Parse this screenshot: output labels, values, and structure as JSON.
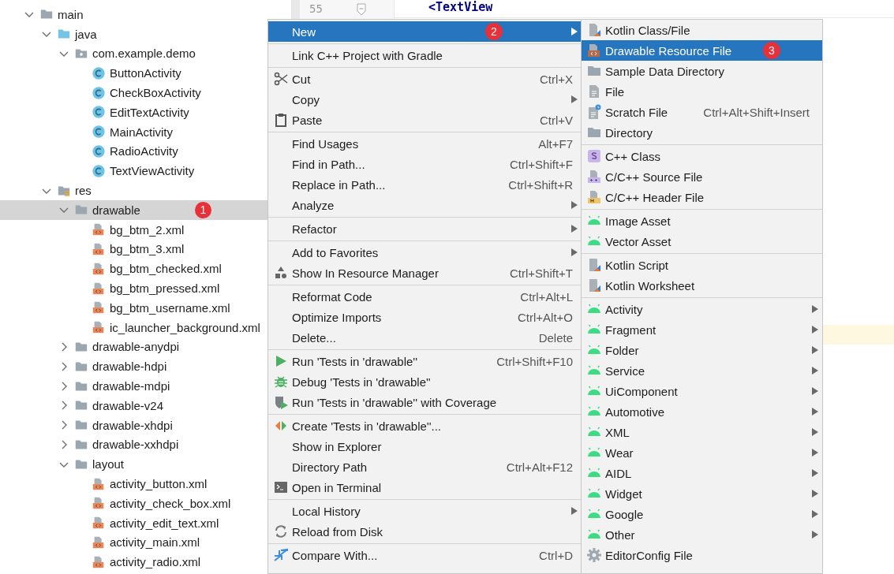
{
  "editor": {
    "line_number": "55",
    "code": "<TextView"
  },
  "tree": [
    {
      "label": "main",
      "kind": "folder",
      "expanded": true,
      "selected": false,
      "children": [
        {
          "label": "java",
          "kind": "java-folder",
          "expanded": true,
          "selected": false,
          "children": [
            {
              "label": "com.example.demo",
              "kind": "package",
              "expanded": true,
              "selected": false,
              "children": [
                {
                  "label": "ButtonActivity",
                  "kind": "class",
                  "selected": false
                },
                {
                  "label": "CheckBoxActivity",
                  "kind": "class",
                  "selected": false
                },
                {
                  "label": "EditTextActivity",
                  "kind": "class",
                  "selected": false
                },
                {
                  "label": "MainActivity",
                  "kind": "class",
                  "selected": false
                },
                {
                  "label": "RadioActivity",
                  "kind": "class",
                  "selected": false
                },
                {
                  "label": "TextViewActivity",
                  "kind": "class",
                  "selected": false
                }
              ]
            }
          ]
        },
        {
          "label": "res",
          "kind": "res-folder",
          "expanded": true,
          "selected": false,
          "children": [
            {
              "label": "drawable",
              "kind": "folder",
              "expanded": true,
              "selected": true,
              "badge": "1",
              "children": [
                {
                  "label": "bg_btm_2.xml",
                  "kind": "xml",
                  "selected": false
                },
                {
                  "label": "bg_btm_3.xml",
                  "kind": "xml",
                  "selected": false
                },
                {
                  "label": "bg_btm_checked.xml",
                  "kind": "xml",
                  "selected": false
                },
                {
                  "label": "bg_btm_pressed.xml",
                  "kind": "xml",
                  "selected": false
                },
                {
                  "label": "bg_btm_username.xml",
                  "kind": "xml",
                  "selected": false
                },
                {
                  "label": "ic_launcher_background.xml",
                  "kind": "xml",
                  "selected": false
                }
              ]
            },
            {
              "label": "drawable-anydpi",
              "kind": "folder",
              "expanded": false,
              "selected": false
            },
            {
              "label": "drawable-hdpi",
              "kind": "folder",
              "expanded": false,
              "selected": false
            },
            {
              "label": "drawable-mdpi",
              "kind": "folder",
              "expanded": false,
              "selected": false
            },
            {
              "label": "drawable-v24",
              "kind": "folder",
              "expanded": false,
              "selected": false
            },
            {
              "label": "drawable-xhdpi",
              "kind": "folder",
              "expanded": false,
              "selected": false
            },
            {
              "label": "drawable-xxhdpi",
              "kind": "folder",
              "expanded": false,
              "selected": false
            },
            {
              "label": "layout",
              "kind": "folder",
              "expanded": true,
              "selected": false,
              "children": [
                {
                  "label": "activity_button.xml",
                  "kind": "xml",
                  "selected": false
                },
                {
                  "label": "activity_check_box.xml",
                  "kind": "xml",
                  "selected": false
                },
                {
                  "label": "activity_edit_text.xml",
                  "kind": "xml",
                  "selected": false
                },
                {
                  "label": "activity_main.xml",
                  "kind": "xml",
                  "selected": false
                },
                {
                  "label": "activity_radio.xml",
                  "kind": "xml",
                  "selected": false
                }
              ]
            }
          ]
        }
      ]
    }
  ],
  "context_menu": {
    "groups": [
      {
        "items": [
          {
            "label": "New",
            "kind": "none",
            "submenu": true,
            "selected": true,
            "badge": "2"
          }
        ]
      },
      {
        "items": [
          {
            "label": "Link C++ Project with Gradle",
            "kind": "none",
            "submenu": false,
            "selected": false
          }
        ]
      },
      {
        "items": [
          {
            "label": "Cut",
            "kind": "cut",
            "shortcut": "Ctrl+X",
            "submenu": false,
            "selected": false
          },
          {
            "label": "Copy",
            "kind": "none",
            "submenu": true,
            "selected": false
          },
          {
            "label": "Paste",
            "kind": "paste",
            "shortcut": "Ctrl+V",
            "submenu": false,
            "selected": false
          }
        ]
      },
      {
        "items": [
          {
            "label": "Find Usages",
            "kind": "none",
            "shortcut": "Alt+F7",
            "submenu": false,
            "selected": false
          },
          {
            "label": "Find in Path...",
            "kind": "none",
            "shortcut": "Ctrl+Shift+F",
            "submenu": false,
            "selected": false
          },
          {
            "label": "Replace in Path...",
            "kind": "none",
            "shortcut": "Ctrl+Shift+R",
            "submenu": false,
            "selected": false
          },
          {
            "label": "Analyze",
            "kind": "none",
            "submenu": true,
            "selected": false
          }
        ]
      },
      {
        "items": [
          {
            "label": "Refactor",
            "kind": "none",
            "submenu": true,
            "selected": false
          }
        ]
      },
      {
        "items": [
          {
            "label": "Add to Favorites",
            "kind": "none",
            "submenu": true,
            "selected": false
          },
          {
            "label": "Show In Resource Manager",
            "kind": "resources",
            "shortcut": "Ctrl+Shift+T",
            "submenu": false,
            "selected": false
          }
        ]
      },
      {
        "items": [
          {
            "label": "Reformat Code",
            "kind": "none",
            "shortcut": "Ctrl+Alt+L",
            "submenu": false,
            "selected": false
          },
          {
            "label": "Optimize Imports",
            "kind": "none",
            "shortcut": "Ctrl+Alt+O",
            "submenu": false,
            "selected": false
          },
          {
            "label": "Delete...",
            "kind": "none",
            "shortcut": "Delete",
            "submenu": false,
            "selected": false
          }
        ]
      },
      {
        "items": [
          {
            "label": "Run 'Tests in 'drawable''",
            "kind": "run",
            "shortcut": "Ctrl+Shift+F10",
            "submenu": false,
            "selected": false
          },
          {
            "label": "Debug 'Tests in 'drawable''",
            "kind": "debug",
            "submenu": false,
            "selected": false
          },
          {
            "label": "Run 'Tests in 'drawable'' with Coverage",
            "kind": "coverage",
            "submenu": false,
            "selected": false
          }
        ]
      },
      {
        "items": [
          {
            "label": "Create 'Tests in 'drawable''...",
            "kind": "create-test",
            "submenu": false,
            "selected": false
          },
          {
            "label": "Show in Explorer",
            "kind": "none",
            "submenu": false,
            "selected": false
          },
          {
            "label": "Directory Path",
            "kind": "none",
            "shortcut": "Ctrl+Alt+F12",
            "submenu": false,
            "selected": false
          },
          {
            "label": "Open in Terminal",
            "kind": "terminal",
            "submenu": false,
            "selected": false
          }
        ]
      },
      {
        "items": [
          {
            "label": "Local History",
            "kind": "none",
            "submenu": true,
            "selected": false
          },
          {
            "label": "Reload from Disk",
            "kind": "reload",
            "submenu": false,
            "selected": false
          }
        ]
      },
      {
        "items": [
          {
            "label": "Compare With...",
            "kind": "compare",
            "shortcut": "Ctrl+D",
            "submenu": false,
            "selected": false
          }
        ]
      }
    ]
  },
  "new_submenu": {
    "groups": [
      {
        "items": [
          {
            "label": "Kotlin Class/File",
            "kind": "kotlin-file",
            "submenu": false,
            "selected": false
          },
          {
            "label": "Drawable Resource File",
            "kind": "drawable-file",
            "submenu": false,
            "selected": true,
            "badge": "3"
          },
          {
            "label": "Sample Data Directory",
            "kind": "folder",
            "submenu": false,
            "selected": false
          },
          {
            "label": "File",
            "kind": "file",
            "submenu": false,
            "selected": false
          },
          {
            "label": "Scratch File",
            "kind": "scratch",
            "shortcut": "Ctrl+Alt+Shift+Insert",
            "submenu": false,
            "selected": false
          },
          {
            "label": "Directory",
            "kind": "folder",
            "submenu": false,
            "selected": false
          }
        ]
      },
      {
        "items": [
          {
            "label": "C++ Class",
            "kind": "cpp-class",
            "submenu": false,
            "selected": false
          },
          {
            "label": "C/C++ Source File",
            "kind": "cpp-source",
            "submenu": false,
            "selected": false
          },
          {
            "label": "C/C++ Header File",
            "kind": "cpp-header",
            "submenu": false,
            "selected": false
          }
        ]
      },
      {
        "items": [
          {
            "label": "Image Asset",
            "kind": "android",
            "submenu": false,
            "selected": false
          },
          {
            "label": "Vector Asset",
            "kind": "android",
            "submenu": false,
            "selected": false
          }
        ]
      },
      {
        "items": [
          {
            "label": "Kotlin Script",
            "kind": "kotlin-script",
            "submenu": false,
            "selected": false
          },
          {
            "label": "Kotlin Worksheet",
            "kind": "kotlin-script",
            "submenu": false,
            "selected": false
          }
        ]
      },
      {
        "items": [
          {
            "label": "Activity",
            "kind": "android",
            "submenu": true,
            "selected": false
          },
          {
            "label": "Fragment",
            "kind": "android",
            "submenu": true,
            "selected": false
          },
          {
            "label": "Folder",
            "kind": "android",
            "submenu": true,
            "selected": false
          },
          {
            "label": "Service",
            "kind": "android",
            "submenu": true,
            "selected": false
          },
          {
            "label": "UiComponent",
            "kind": "android",
            "submenu": true,
            "selected": false
          },
          {
            "label": "Automotive",
            "kind": "android",
            "submenu": true,
            "selected": false
          },
          {
            "label": "XML",
            "kind": "android",
            "submenu": true,
            "selected": false
          },
          {
            "label": "Wear",
            "kind": "android",
            "submenu": true,
            "selected": false
          },
          {
            "label": "AIDL",
            "kind": "android",
            "submenu": true,
            "selected": false
          },
          {
            "label": "Widget",
            "kind": "android",
            "submenu": true,
            "selected": false
          },
          {
            "label": "Google",
            "kind": "android",
            "submenu": true,
            "selected": false
          },
          {
            "label": "Other",
            "kind": "android",
            "submenu": true,
            "selected": false
          },
          {
            "label": "EditorConfig File",
            "kind": "gear",
            "submenu": false,
            "selected": false
          }
        ]
      }
    ]
  }
}
